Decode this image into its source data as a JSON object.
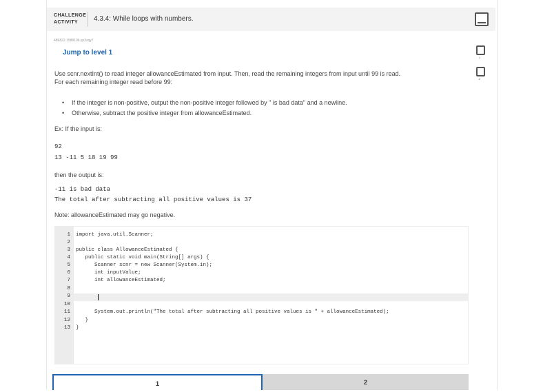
{
  "header": {
    "challenge_label_1": "CHALLENGE",
    "challenge_label_2": "ACTIVITY",
    "title": "4.3.4: While loops with numbers."
  },
  "ref_code": "486822.1588106.qx3zqy7",
  "jump_link": "Jump to level 1",
  "description": {
    "line1": "Use scnr.nextInt() to read integer allowanceEstimated from input. Then, read the remaining integers from input until 99 is read.",
    "line2": "For each remaining integer read before 99:"
  },
  "bullets": [
    "If the integer is non-positive, output the non-positive integer followed by \" is bad data\" and a newline.",
    "Otherwise, subtract the positive integer from allowanceEstimated."
  ],
  "example": {
    "input_label": "Ex: If the input is:",
    "input_line1": "92",
    "input_line2": "13 -11 5 18 19 99",
    "output_label": "then the output is:",
    "output_line1": "-11 is bad data",
    "output_line2": "The total after subtracting all positive values is 37"
  },
  "note": "Note: allowanceEstimated may go negative.",
  "code_editor": {
    "line_numbers": [
      "1",
      "2",
      "3",
      "4",
      "5",
      "6",
      "7",
      "8",
      "9",
      "10",
      "11",
      "12",
      "13"
    ],
    "lines": [
      "import java.util.Scanner;",
      "",
      "public class AllowanceEstimated {",
      "   public static void main(String[] args) {",
      "      Scanner scnr = new Scanner(System.in);",
      "      int inputValue;",
      "      int allowanceEstimated;",
      "",
      "",
      "",
      "      System.out.println(\"The total after subtracting all positive values is \" + allowanceEstimated);",
      "   }",
      "}"
    ]
  },
  "level_tabs": [
    "1",
    "2"
  ],
  "side_levels": [
    "1",
    "2"
  ]
}
